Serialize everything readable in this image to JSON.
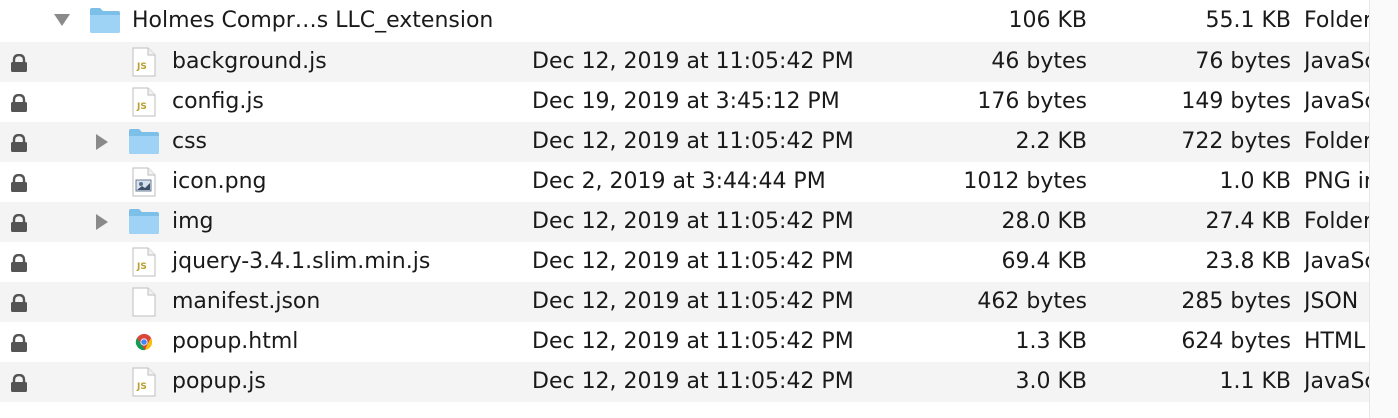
{
  "folder": {
    "name": "Holmes Compr…s LLC_extension",
    "size": "106 KB",
    "compressed": "55.1 KB",
    "kind": "Folder",
    "expanded": true,
    "icon": "folder-icon"
  },
  "files": [
    {
      "name": "background.js",
      "date": "Dec 12, 2019 at 11:05:42 PM",
      "size": "46 bytes",
      "compressed": "76 bytes",
      "kind": "JavaScript",
      "icon": "js-file-icon",
      "expandable": false
    },
    {
      "name": "config.js",
      "date": "Dec 19, 2019 at 3:45:12 PM",
      "size": "176 bytes",
      "compressed": "149 bytes",
      "kind": "JavaScript",
      "icon": "js-file-icon",
      "expandable": false
    },
    {
      "name": "css",
      "date": "Dec 12, 2019 at 11:05:42 PM",
      "size": "2.2 KB",
      "compressed": "722 bytes",
      "kind": "Folder",
      "icon": "folder-icon",
      "expandable": true
    },
    {
      "name": "icon.png",
      "date": "Dec 2, 2019 at 3:44:44 PM",
      "size": "1012 bytes",
      "compressed": "1.0 KB",
      "kind": "PNG image",
      "icon": "png-file-icon",
      "expandable": false
    },
    {
      "name": "img",
      "date": "Dec 12, 2019 at 11:05:42 PM",
      "size": "28.0 KB",
      "compressed": "27.4 KB",
      "kind": "Folder",
      "icon": "folder-icon",
      "expandable": true
    },
    {
      "name": "jquery-3.4.1.slim.min.js",
      "date": "Dec 12, 2019 at 11:05:42 PM",
      "size": "69.4 KB",
      "compressed": "23.8 KB",
      "kind": "JavaScript",
      "icon": "js-file-icon",
      "expandable": false
    },
    {
      "name": "manifest.json",
      "date": "Dec 12, 2019 at 11:05:42 PM",
      "size": "462 bytes",
      "compressed": "285 bytes",
      "kind": "JSON",
      "icon": "json-file-icon",
      "expandable": false
    },
    {
      "name": "popup.html",
      "date": "Dec 12, 2019 at 11:05:42 PM",
      "size": "1.3 KB",
      "compressed": "624 bytes",
      "kind": "HTML",
      "icon": "html-file-icon",
      "expandable": false
    },
    {
      "name": "popup.js",
      "date": "Dec 12, 2019 at 11:05:42 PM",
      "size": "3.0 KB",
      "compressed": "1.1 KB",
      "kind": "JavaScript",
      "icon": "js-file-icon",
      "expandable": false
    }
  ],
  "colors": {
    "folder_blue": "#8ccbf2",
    "js_label": "#b8a032",
    "stripe": "#f4f4f4"
  }
}
